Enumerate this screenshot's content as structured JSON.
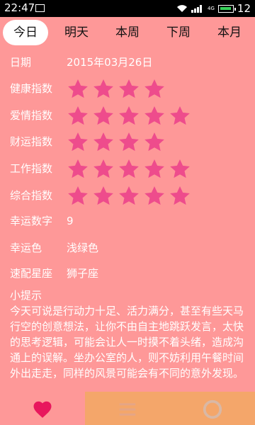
{
  "status_bar": {
    "time": "22:47",
    "signal_type": "4G",
    "battery_number": "12",
    "icons": [
      "image-icon",
      "wifi-icon",
      "signal-icon",
      "battery-icon"
    ]
  },
  "tabs": [
    {
      "label": "今日",
      "active": true
    },
    {
      "label": "明天",
      "active": false
    },
    {
      "label": "本周",
      "active": false
    },
    {
      "label": "下周",
      "active": false
    },
    {
      "label": "本月",
      "active": false
    }
  ],
  "fortune": {
    "date_label": "日期",
    "date_value": "2015年03月26日",
    "ratings": [
      {
        "label": "健康指数",
        "stars": 4
      },
      {
        "label": "爱情指数",
        "stars": 5
      },
      {
        "label": "财运指数",
        "stars": 4
      },
      {
        "label": "工作指数",
        "stars": 5
      },
      {
        "label": "综合指数",
        "stars": 5
      }
    ],
    "lucky_number_label": "幸运数字",
    "lucky_number_value": "9",
    "lucky_color_label": "幸运色",
    "lucky_color_value": "浅绿色",
    "match_sign_label": "速配星座",
    "match_sign_value": "狮子座",
    "tip_title": "小提示",
    "tip_text": "今天可说是行动力十足、活力满分，甚至有些天马行空的创意想法，让你不由自主地跳跃发言，太快的思考逻辑，可能会让人一时摸不着头绪，造成沟通上的误解。坐办公室的人，则不妨利用午餐时间外出走走，同样的风景可能会有不同的意外发现。"
  },
  "bottom_nav": [
    {
      "icon": "heart-icon"
    },
    {
      "icon": "list-icon"
    },
    {
      "icon": "ring-icon"
    }
  ],
  "colors": {
    "background": "#fe9898",
    "star": "#ee4c8c",
    "nav_alt": "#f4a66a",
    "heart": "#e8175d"
  }
}
